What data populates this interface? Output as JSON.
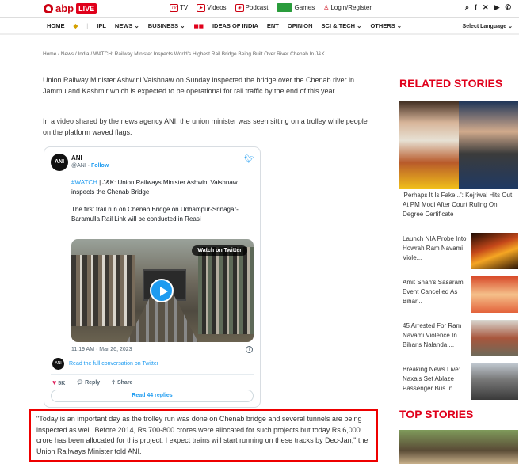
{
  "header": {
    "logo_text": "abp",
    "live_badge": "LIVE",
    "links": [
      {
        "icon": "tv-icon",
        "label": "TV"
      },
      {
        "icon": "video-icon",
        "label": "Videos"
      },
      {
        "icon": "podcast-icon",
        "label": "Podcast"
      },
      {
        "icon": "games-icon",
        "label": "Games"
      },
      {
        "icon": "user-icon",
        "label": "Login/Register"
      }
    ]
  },
  "nav": {
    "items": [
      "HOME",
      "IPL",
      "NEWS",
      "BUSINESS",
      "IDEAS OF INDIA",
      "ENT",
      "OPINION",
      "SCI & TECH",
      "OTHERS"
    ],
    "language": "Select Language"
  },
  "breadcrumb": "Home / News / India / WATCH: Railway Minister Inspects World's Highest Rail Bridge Being Built Over River Chenab In J&K",
  "article": {
    "para1": "Union Railway Minister Ashwini Vaishnaw on Sunday inspected the bridge over the Chenab river in Jammu and Kashmir which is expected to be operational for rail traffic by the end of this year.",
    "para2": "In a video shared by the news agency ANI, the union minister was seen sitting on a trolley while people on the platform waved flags.",
    "quote": "\"Today is an important day as the trolley run was done on Chenab bridge and several tunnels are being inspected as well. Before 2014, Rs 700-800 crores were allocated for such projects but today Rs 6,000 crore has been allocated for this project. I expect trains will start running on these tracks by Dec-Jan,\" the Union Railways Minister told ANI."
  },
  "tweet": {
    "name": "ANI",
    "handle": "@ANI",
    "follow": "Follow",
    "hashtag": "#WATCH",
    "text1": " | J&K: Union Railways Minister Ashwini Vaishnaw inspects the Chenab Bridge",
    "text2": "The first trail run on Chenab Bridge on Udhampur-Srinagar-Baramulla Rail Link will be conducted in Reasi",
    "watch_label": "Watch on Twitter",
    "time": "11:19 AM · Mar 26, 2023",
    "convo": "Read the full conversation on Twitter",
    "likes": "5K",
    "reply": "Reply",
    "share": "Share",
    "replies": "Read 44 replies"
  },
  "sidebar": {
    "related_title": "RELATED STORIES",
    "big_caption": "'Perhaps It Is Fake...': Kejriwal Hits Out At PM Modi After Court Ruling On Degree Certificate",
    "stories": [
      "Launch NIA Probe Into Howrah Ram Navami Viole...",
      "Amit Shah's Sasaram Event Cancelled As Bihar...",
      "45 Arrested For Ram Navami Violence In Bihar's Nalanda,...",
      "Breaking News Live: Naxals Set Ablaze Passenger Bus In..."
    ],
    "top_title": "TOP STORIES"
  }
}
